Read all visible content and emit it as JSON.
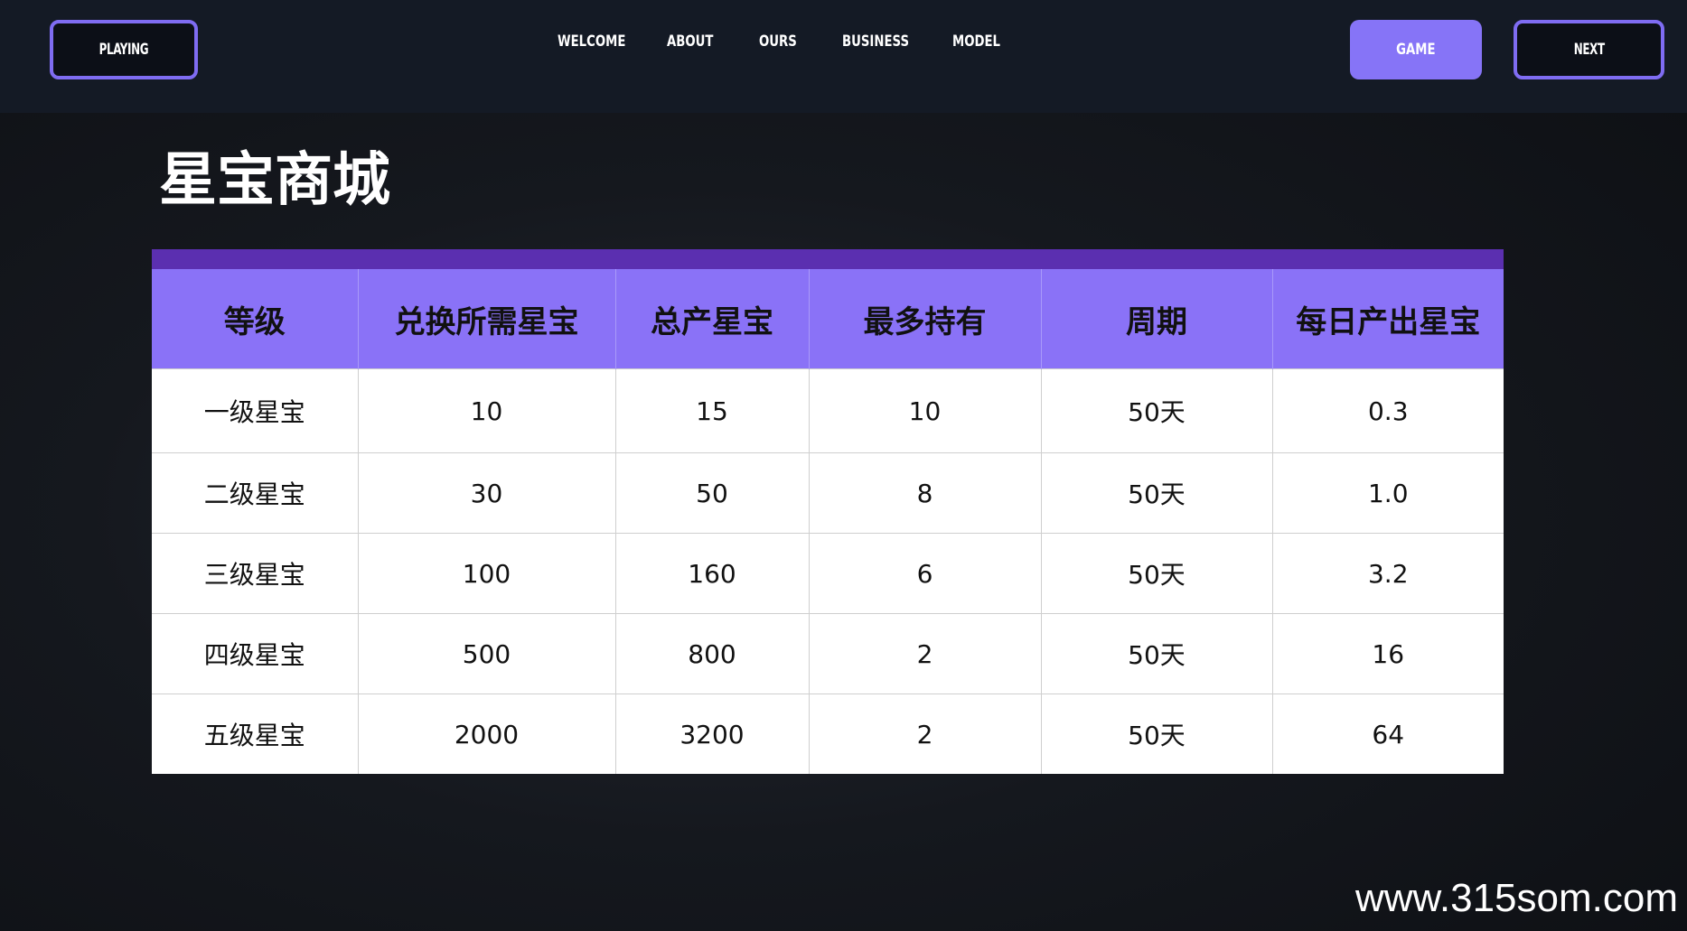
{
  "header": {
    "left_button": "PLAYING",
    "nav": [
      "WELCOME",
      "ABOUT",
      "OURS",
      "BUSINESS",
      "MODEL"
    ],
    "game_button": "GAME",
    "next_button": "NEXT",
    "accent_color": "#8674f7"
  },
  "page": {
    "title": "星宝商城"
  },
  "table": {
    "headers": [
      "等级",
      "兑换所需星宝",
      "总产星宝",
      "最多持有",
      "周期",
      "每日产出星宝"
    ],
    "rows": [
      [
        "一级星宝",
        "10",
        "15",
        "10",
        "50天",
        "0.3"
      ],
      [
        "二级星宝",
        "30",
        "50",
        "8",
        "50天",
        "1.0"
      ],
      [
        "三级星宝",
        "100",
        "160",
        "6",
        "50天",
        "3.2"
      ],
      [
        "四级星宝",
        "500",
        "800",
        "2",
        "50天",
        "16"
      ],
      [
        "五级星宝",
        "2000",
        "3200",
        "2",
        "50天",
        "64"
      ]
    ],
    "header_color": "#8a72f7",
    "topbar_color": "#5b2fb0"
  },
  "watermark": "www.315som.com"
}
